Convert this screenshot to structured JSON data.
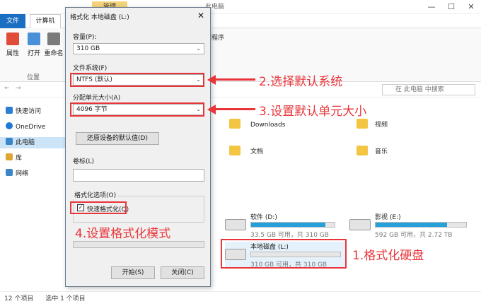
{
  "explorer": {
    "context_tab": "管理",
    "context_path": "此电脑",
    "window_buttons": [
      "—",
      "☐",
      "✕"
    ],
    "tabs": {
      "file": "文件",
      "computer": "计算机"
    },
    "ribbon": {
      "properties": "属性",
      "open": "打开",
      "rename": "重命名",
      "group_location": "位置",
      "uninstall_partial": "改程序"
    },
    "search_placeholder": "在 此电脑 中搜索",
    "sidebar": [
      "快速访问",
      "OneDrive",
      "此电脑",
      "库",
      "网络"
    ],
    "folders": [
      {
        "name": "Downloads"
      },
      {
        "name": "视频"
      },
      {
        "name": "文档"
      },
      {
        "name": "音乐"
      }
    ],
    "drives": [
      {
        "name": "软件 (D:)",
        "info": "33.5 GB 可用，共 310 GB",
        "used_fraction": 0.89
      },
      {
        "name": "影视 (E:)",
        "info": "592 GB 可用，共 2.72 TB",
        "used_fraction": 0.79
      },
      {
        "name": "本地磁盘 (L:)",
        "info": "310 GB 可用，共 310 GB",
        "used_fraction": 0.0
      }
    ],
    "status": {
      "count": "12 个项目",
      "selected": "选中 1 个项目"
    }
  },
  "dialog": {
    "title": "格式化 本地磁盘 (L:)",
    "close": "✕",
    "capacity_label": "容量(P):",
    "capacity_value": "310 GB",
    "fs_label": "文件系统(F)",
    "fs_value": "NTFS (默认)",
    "alloc_label": "分配单元大小(A)",
    "alloc_value": "4096 字节",
    "restore_button": "还原设备的默认值(D)",
    "volume_label": "卷标(L)",
    "volume_value": "",
    "options_label": "格式化选项(O)",
    "quick_format": "快速格式化(Q)",
    "quick_checked": "✓",
    "start_button": "开始(S)",
    "close_button": "关闭(C)"
  },
  "annotations": {
    "step1": "1.格式化硬盘",
    "step2": "2.选择默认系统",
    "step3": "3.设置默认单元大小",
    "step4": "4.设置格式化模式"
  },
  "colors": {
    "accent": "#1a6fc2",
    "annotation": "#e8353a",
    "drive_bar": "#26a0da"
  }
}
